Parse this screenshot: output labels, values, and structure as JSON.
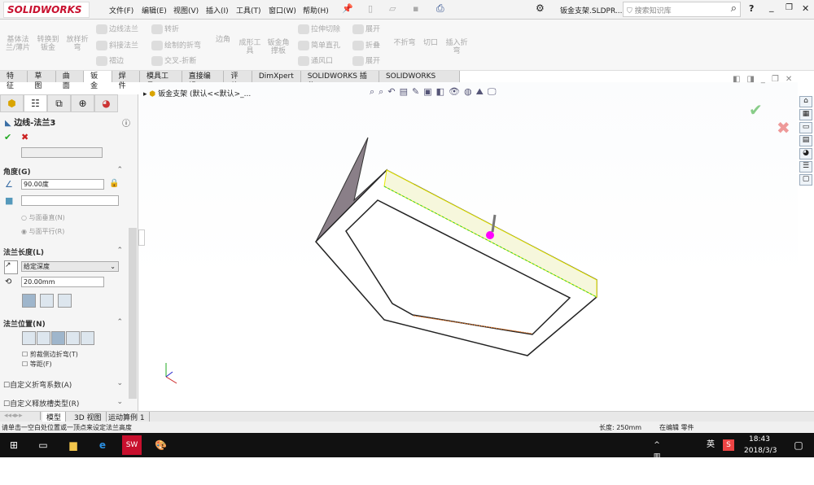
{
  "app": {
    "logo": "SOLIDWORKS",
    "file_title": "钣金支架.SLDPR...",
    "search_placeholder": "搜索知识库"
  },
  "menu": [
    "文件(F)",
    "编辑(E)",
    "视图(V)",
    "插入(I)",
    "工具(T)",
    "窗口(W)",
    "帮助(H)"
  ],
  "ribbon": {
    "base_flange": "基体法兰/薄片",
    "convert": "转换到钣金",
    "lofted": "放样折弯",
    "edge_flange": "边线法兰",
    "miter_flange": "斜接法兰",
    "hem": "褶边",
    "jog": "转折",
    "sketched_bend": "绘制的折弯",
    "cross_break": "交叉-折断",
    "corner": "边角",
    "forming_tool": "成形工具",
    "gusset": "钣金角撑板",
    "extruded_cut": "拉伸切除",
    "simple_hole": "简单直孔",
    "vent": "通风口",
    "unfold": "展开",
    "fold": "折叠",
    "flatten": "展开",
    "no_bends": "不折弯",
    "rip": "切口",
    "insert_bends": "插入折弯"
  },
  "tabs": [
    "特征",
    "草图",
    "曲面",
    "钣金",
    "焊件",
    "模具工具",
    "直接编辑",
    "评估",
    "DimXpert",
    "SOLIDWORKS 插件",
    "SOLIDWORKS MBD"
  ],
  "active_tab": "钣金",
  "tree": {
    "part": "钣金支架",
    "config": "(默认<<默认>_..."
  },
  "panel": {
    "title": "边线-法兰3",
    "angle": {
      "header": "角度(G)",
      "value": "90.00度",
      "face_field": "",
      "opt_perp": "与面垂直(N)",
      "opt_parallel": "与面平行(R)"
    },
    "length": {
      "header": "法兰长度(L)",
      "type": "给定深度",
      "value": "20.00mm"
    },
    "position": {
      "header": "法兰位置(N)",
      "trim": "剪裁侧边折弯(T)",
      "offset": "等距(F)"
    },
    "custom_bend": "自定义折弯系数(A)",
    "custom_relief": "自定义释放槽类型(R)"
  },
  "bottom_tabs": [
    "模型",
    "3D 视图",
    "运动算例 1"
  ],
  "status": {
    "message": "请单击一空白处位置或一顶点来设定法兰高度",
    "length": "长度: 250mm",
    "editing": "在编辑 零件"
  },
  "taskbar": {
    "time": "18:43",
    "date": "2018/3/3",
    "ime": "英"
  },
  "colors": {
    "accent": "#c8102e",
    "flange_edge": "#e8e800",
    "selection": "#ff00ff"
  }
}
